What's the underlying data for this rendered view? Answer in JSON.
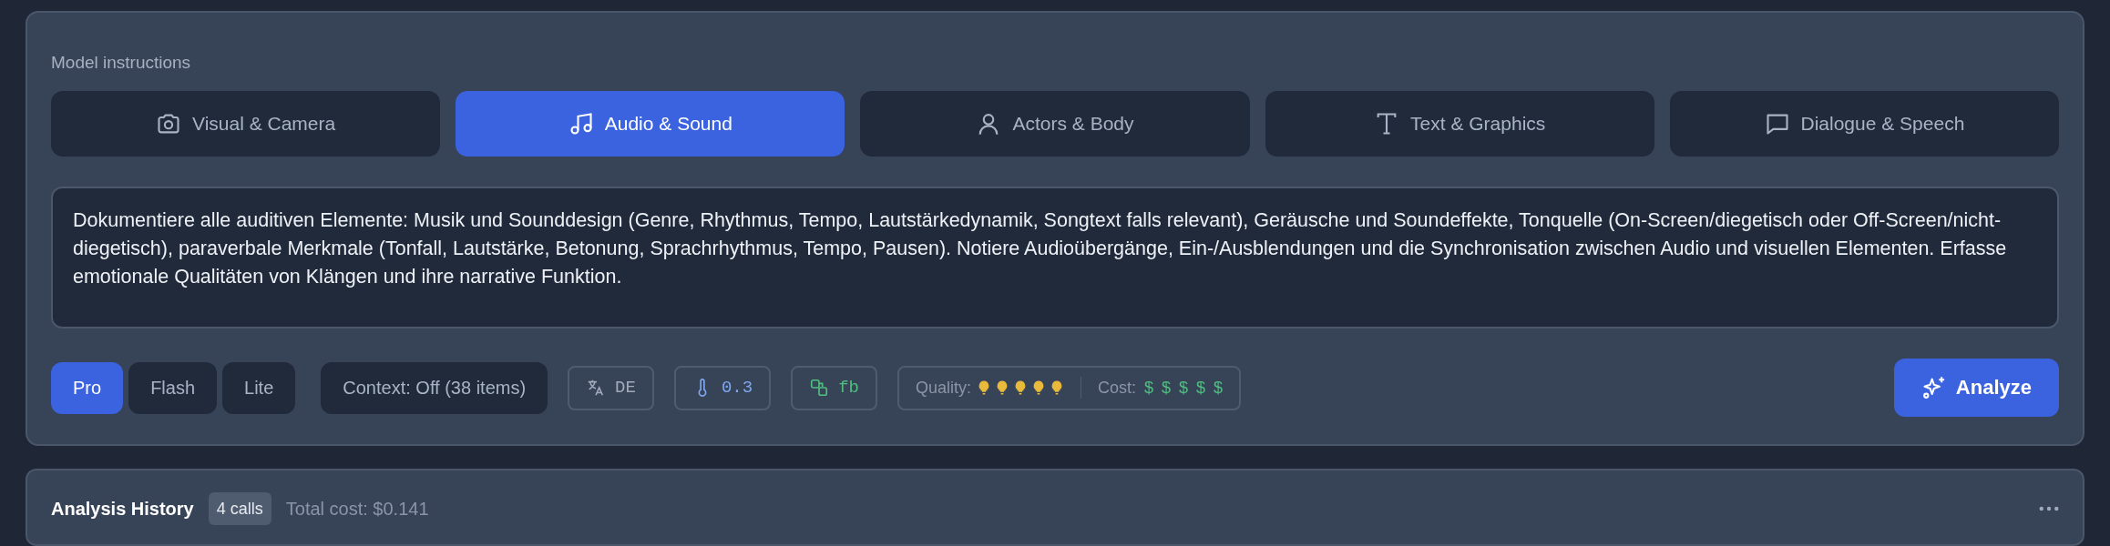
{
  "panel": {
    "title": "Model instructions"
  },
  "tabs": [
    {
      "label": "Visual & Camera",
      "kind": "camera",
      "selected": false
    },
    {
      "label": "Audio & Sound",
      "kind": "music",
      "selected": true
    },
    {
      "label": "Actors & Body",
      "kind": "person",
      "selected": false
    },
    {
      "label": "Text & Graphics",
      "kind": "text",
      "selected": false
    },
    {
      "label": "Dialogue & Speech",
      "kind": "chat",
      "selected": false
    }
  ],
  "instructions": "Dokumentiere alle auditiven Elemente: Musik und Sounddesign (Genre, Rhythmus, Tempo, Lautstärkedynamik, Songtext falls relevant), Geräusche und Soundeffekte, Tonquelle (On-Screen/diegetisch oder Off-Screen/nicht-diegetisch), paraverbale Merkmale (Tonfall, Lautstärke, Betonung, Sprachrhythmus, Tempo, Pausen). Notiere Audioübergänge, Ein-/Ausblendungen und die Synchronisation zwischen Audio und visuellen Elementen. Erfasse emotionale Qualitäten von Klängen und ihre narrative Funktion.",
  "models": [
    {
      "label": "Pro",
      "selected": true
    },
    {
      "label": "Flash",
      "selected": false
    },
    {
      "label": "Lite",
      "selected": false
    }
  ],
  "context_button": "Context: Off (38 items)",
  "chips": [
    {
      "kind": "language",
      "label": "DE"
    },
    {
      "kind": "temperature",
      "label": "0.3"
    },
    {
      "kind": "fallback",
      "label": "fb"
    }
  ],
  "quality": {
    "label": "Quality:",
    "stars": 5
  },
  "cost": {
    "label": "Cost:",
    "signs": [
      "$",
      "$",
      "$",
      "$",
      "$"
    ]
  },
  "analyze_button": "Analyze",
  "history": {
    "title": "Analysis History",
    "count": "4 calls",
    "total": "Total cost: $0.141"
  }
}
